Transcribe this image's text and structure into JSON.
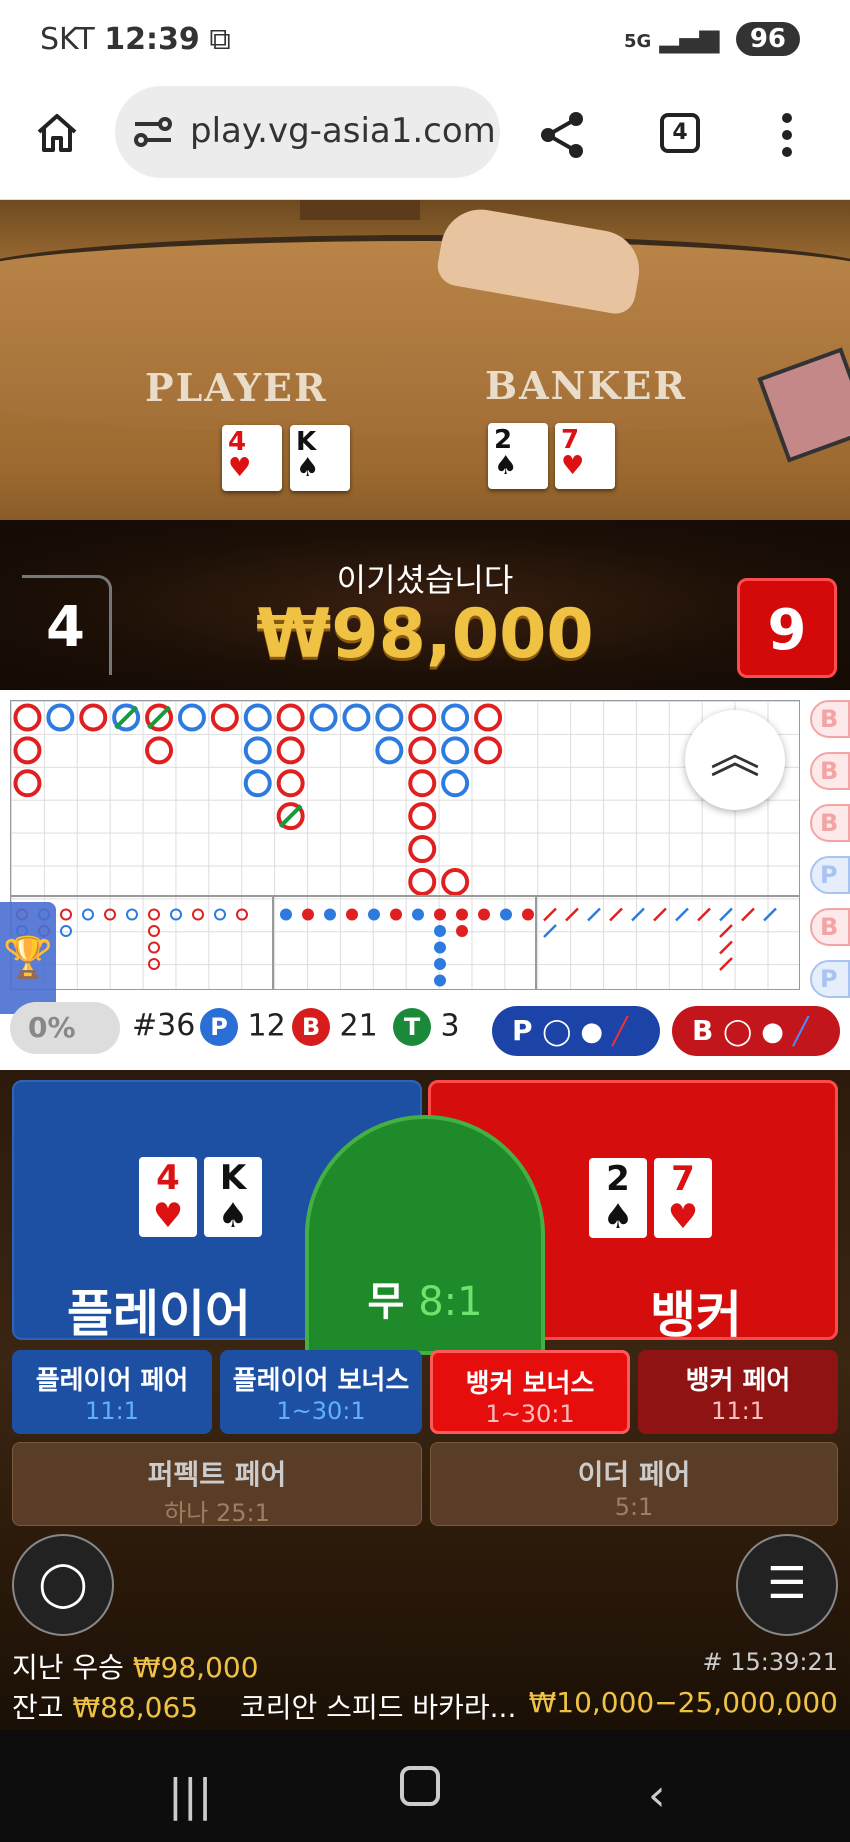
{
  "status_bar": {
    "carrier": "SKT",
    "time": "12:39",
    "network": "5G",
    "battery": "96"
  },
  "browser": {
    "url": "play.vg-asia1.com",
    "tab_count": "4"
  },
  "table": {
    "player_label": "PLAYER",
    "banker_label": "BANKER",
    "player_cards": [
      {
        "rank": "4",
        "suit": "♥"
      },
      {
        "rank": "K",
        "suit": "♠"
      }
    ],
    "banker_cards": [
      {
        "rank": "2",
        "suit": "♠"
      },
      {
        "rank": "7",
        "suit": "♥"
      }
    ],
    "player_score": "4",
    "banker_score": "9",
    "win_title": "이기셨습니다",
    "win_amount": "₩98,000"
  },
  "stats": {
    "percent": "0%",
    "round": "#36",
    "player_letter": "P",
    "player_count": "12",
    "banker_letter": "B",
    "banker_count": "21",
    "tie_letter": "T",
    "tie_count": "3",
    "p_predict": "P",
    "b_predict": "B"
  },
  "side_road": [
    "B",
    "B",
    "B",
    "P",
    "B",
    "P"
  ],
  "bets": {
    "player": "플레이어",
    "banker": "뱅커",
    "tie": "무",
    "tie_odds": "8:1",
    "player_pair": "플레이어 페어",
    "player_pair_odds": "11:1",
    "player_bonus": "플레이어 보너스",
    "player_bonus_odds": "1~30:1",
    "banker_bonus": "뱅커 보너스",
    "banker_bonus_odds": "1~30:1",
    "banker_pair": "뱅커 페어",
    "banker_pair_odds": "11:1",
    "perfect_pair": "퍼펙트 페어",
    "perfect_pair_odds": "하나 25:1",
    "either_pair": "이더 페어",
    "either_pair_odds": "5:1"
  },
  "footer": {
    "last_win_label": "지난 우승",
    "last_win_amount": "₩98,000",
    "game_id": "# 15:39:21",
    "balance_label": "잔고",
    "balance": "₩88,065",
    "table_name": "코리안 스피드 바카라...",
    "limits": "₩10,000−25,000,000"
  },
  "colors": {
    "player_blue": "#1d4fa3",
    "banker_red": "#d60d0d",
    "tie_green": "#1f8a2a",
    "gold": "#f0c243"
  }
}
